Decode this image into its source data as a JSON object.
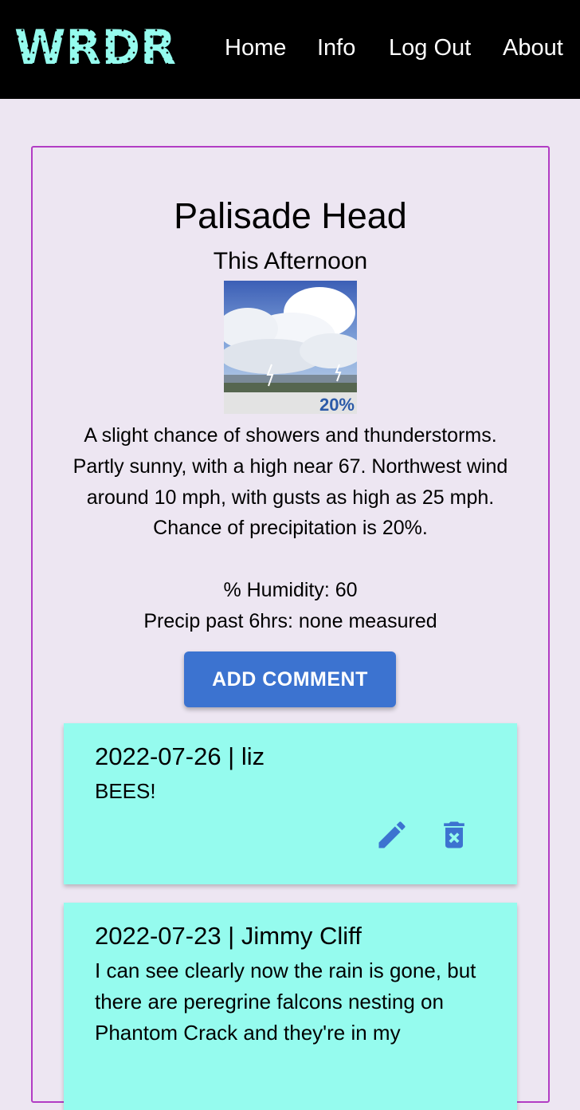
{
  "app": {
    "logo_text": "WRDR",
    "brand_color": "#95fbee"
  },
  "nav": {
    "items": [
      "Home",
      "Info",
      "Log Out",
      "About"
    ]
  },
  "location": {
    "name": "Palisade Head",
    "period": "This Afternoon",
    "image_badge": "20%",
    "forecast": "A slight chance of showers and thunderstorms. Partly sunny, with a high near 67. Northwest wind around 10 mph, with gusts as high as 25 mph. Chance of precipitation is 20%.",
    "humidity": "% Humidity: 60",
    "precip": "Precip past 6hrs: none measured"
  },
  "actions": {
    "add_comment": "ADD COMMENT"
  },
  "comments": [
    {
      "header": "2022-07-26 | liz",
      "body": "BEES!",
      "edit_icon": "pencil-icon",
      "delete_icon": "trash-x-icon"
    },
    {
      "header": "2022-07-23 | Jimmy Cliff",
      "body": "I can see clearly now the rain is gone, but there are peregrine falcons nesting on Phantom Crack and they're in my"
    }
  ],
  "colors": {
    "header_bg": "#000000",
    "page_bg": "#ede6f2",
    "card_border": "#b23cc4",
    "button_bg": "#3c73d0",
    "comment_bg": "#95fbee",
    "icon_color": "#3c73d0"
  }
}
